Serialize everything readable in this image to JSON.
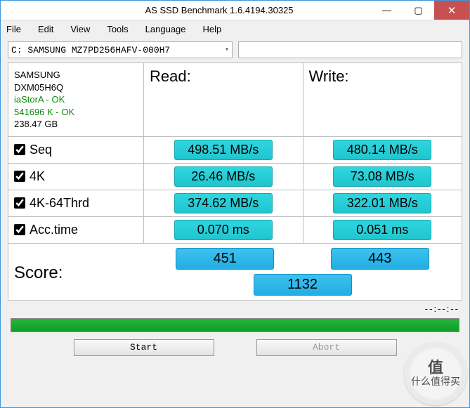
{
  "window": {
    "title": "AS SSD Benchmark 1.6.4194.30325"
  },
  "controls": {
    "min": "—",
    "max": "▢",
    "close": "✕"
  },
  "menu": {
    "file": "File",
    "edit": "Edit",
    "view": "View",
    "tools": "Tools",
    "language": "Language",
    "help": "Help"
  },
  "drive": {
    "selected": "C: SAMSUNG MZ7PD256HAFV-000H7",
    "arrow": "▾"
  },
  "info": {
    "line1": "SAMSUNG",
    "line2": "DXM05H6Q",
    "line3": "iaStorA - OK",
    "line4": "541696 K - OK",
    "line5": "238.47 GB"
  },
  "headers": {
    "read": "Read:",
    "write": "Write:"
  },
  "rows": {
    "seq": {
      "label": "Seq",
      "read": "498.51 MB/s",
      "write": "480.14 MB/s"
    },
    "k4": {
      "label": "4K",
      "read": "26.46 MB/s",
      "write": "73.08 MB/s"
    },
    "k4t": {
      "label": "4K-64Thrd",
      "read": "374.62 MB/s",
      "write": "322.01 MB/s"
    },
    "acc": {
      "label": "Acc.time",
      "read": "0.070 ms",
      "write": "0.051 ms"
    }
  },
  "score": {
    "label": "Score:",
    "read": "451",
    "write": "443",
    "total": "1132"
  },
  "status": {
    "time": "--:--:--"
  },
  "buttons": {
    "start": "Start",
    "abort": "Abort"
  },
  "watermark": {
    "char": "值",
    "text": "什么值得买"
  }
}
